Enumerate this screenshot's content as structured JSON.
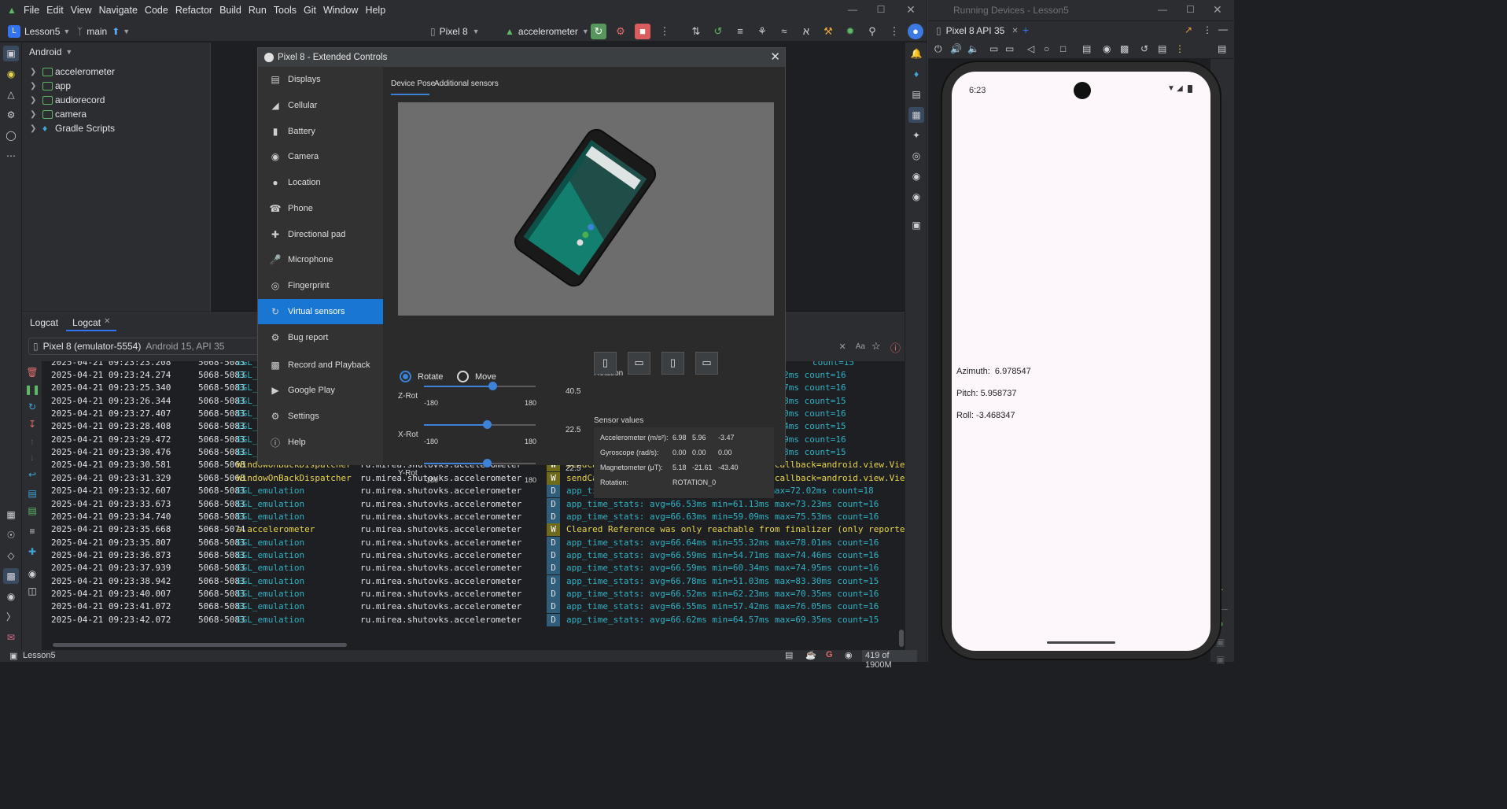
{
  "ide": {
    "menus": [
      "File",
      "Edit",
      "View",
      "Navigate",
      "Code",
      "Refactor",
      "Build",
      "Run",
      "Tools",
      "Git",
      "Window",
      "Help"
    ],
    "project_badge": "L",
    "project_name": "Lesson5",
    "branch": "main",
    "device": "Pixel 8",
    "run_config": "accelerometer",
    "project_view": "Android",
    "tree": [
      "accelerometer",
      "app",
      "audiorecord",
      "camera",
      "Gradle Scripts"
    ],
    "logcat_tabs": [
      "Logcat",
      "Logcat"
    ],
    "logcat_device": "Pixel 8 (emulator-5554)",
    "logcat_device_detail": "Android 15, API 35",
    "search_aa": "Aa",
    "status_project": "Lesson5",
    "memory": "419 of 1900M"
  },
  "logs": [
    {
      "date": "2025-04-21 09:23:24.274",
      "pid": "5068-5083",
      "tag": "EGL_",
      "pkg": "",
      "lvl": "",
      "msg": "=70.52ms count=16"
    },
    {
      "date": "2025-04-21 09:23:25.340",
      "pid": "5068-5083",
      "tag": "EGL_",
      "pkg": "",
      "lvl": "",
      "msg": "=67.47ms count=16"
    },
    {
      "date": "2025-04-21 09:23:26.344",
      "pid": "5068-5083",
      "tag": "EGL_",
      "pkg": "",
      "lvl": "",
      "msg": "=70.68ms count=15"
    },
    {
      "date": "2025-04-21 09:23:27.407",
      "pid": "5068-5083",
      "tag": "EGL_",
      "pkg": "",
      "lvl": "",
      "msg": "=84.00ms count=16"
    },
    {
      "date": "2025-04-21 09:23:28.408",
      "pid": "5068-5083",
      "tag": "EGL_",
      "pkg": "",
      "lvl": "",
      "msg": "=68.84ms count=15"
    },
    {
      "date": "2025-04-21 09:23:29.472",
      "pid": "5068-5083",
      "tag": "EGL_",
      "pkg": "",
      "lvl": "",
      "msg": "=67.79ms count=16"
    },
    {
      "date": "2025-04-21 09:23:30.476",
      "pid": "5068-5083",
      "tag": "EGL_",
      "pkg": "",
      "lvl": "",
      "msg": "=99.43ms count=15"
    },
    {
      "date": "2025-04-21 09:23:30.581",
      "pid": "5068-5068",
      "tag": "WindowOnBackDispatcher",
      "pkg": "ru.mirea.shutovks.accelerometer",
      "lvl": "W",
      "msg": "sendCancelIfRunning: isInProgress=false callback=android.view.View"
    },
    {
      "date": "2025-04-21 09:23:31.329",
      "pid": "5068-5068",
      "tag": "WindowOnBackDispatcher",
      "pkg": "ru.mirea.shutovks.accelerometer",
      "lvl": "W",
      "msg": "sendCancelIfRunning: isInProgress=false callback=android.view.View"
    },
    {
      "date": "2025-04-21 09:23:32.607",
      "pid": "5068-5083",
      "tag": "EGL_emulation",
      "pkg": "ru.mirea.shutovks.accelerometer",
      "lvl": "D",
      "msg": "app_time_stats: avg=58.92ms min=6.45ms max=72.02ms count=18"
    },
    {
      "date": "2025-04-21 09:23:33.673",
      "pid": "5068-5083",
      "tag": "EGL_emulation",
      "pkg": "ru.mirea.shutovks.accelerometer",
      "lvl": "D",
      "msg": "app_time_stats: avg=66.53ms min=61.13ms max=73.23ms count=16"
    },
    {
      "date": "2025-04-21 09:23:34.740",
      "pid": "5068-5083",
      "tag": "EGL_emulation",
      "pkg": "ru.mirea.shutovks.accelerometer",
      "lvl": "D",
      "msg": "app_time_stats: avg=66.63ms min=59.09ms max=75.53ms count=16"
    },
    {
      "date": "2025-04-21 09:23:35.668",
      "pid": "5068-5074",
      "tag": "s.accelerometer",
      "pkg": "ru.mirea.shutovks.accelerometer",
      "lvl": "W",
      "msg": "Cleared Reference was only reachable from finalizer (only reported"
    },
    {
      "date": "2025-04-21 09:23:35.807",
      "pid": "5068-5083",
      "tag": "EGL_emulation",
      "pkg": "ru.mirea.shutovks.accelerometer",
      "lvl": "D",
      "msg": "app_time_stats: avg=66.64ms min=55.32ms max=78.01ms count=16"
    },
    {
      "date": "2025-04-21 09:23:36.873",
      "pid": "5068-5083",
      "tag": "EGL_emulation",
      "pkg": "ru.mirea.shutovks.accelerometer",
      "lvl": "D",
      "msg": "app_time_stats: avg=66.59ms min=54.71ms max=74.46ms count=16"
    },
    {
      "date": "2025-04-21 09:23:37.939",
      "pid": "5068-5083",
      "tag": "EGL_emulation",
      "pkg": "ru.mirea.shutovks.accelerometer",
      "lvl": "D",
      "msg": "app_time_stats: avg=66.59ms min=60.34ms max=74.95ms count=16"
    },
    {
      "date": "2025-04-21 09:23:38.942",
      "pid": "5068-5083",
      "tag": "EGL_emulation",
      "pkg": "ru.mirea.shutovks.accelerometer",
      "lvl": "D",
      "msg": "app_time_stats: avg=66.78ms min=51.03ms max=83.30ms count=15"
    },
    {
      "date": "2025-04-21 09:23:40.007",
      "pid": "5068-5083",
      "tag": "EGL_emulation",
      "pkg": "ru.mirea.shutovks.accelerometer",
      "lvl": "D",
      "msg": "app_time_stats: avg=66.52ms min=62.23ms max=70.35ms count=16"
    },
    {
      "date": "2025-04-21 09:23:41.072",
      "pid": "5068-5083",
      "tag": "EGL_emulation",
      "pkg": "ru.mirea.shutovks.accelerometer",
      "lvl": "D",
      "msg": "app_time_stats: avg=66.55ms min=57.42ms max=76.05ms count=16"
    },
    {
      "date": "2025-04-21 09:23:42.072",
      "pid": "5068-5083",
      "tag": "EGL_emulation",
      "pkg": "ru.mirea.shutovks.accelerometer",
      "lvl": "D",
      "msg": "app_time_stats: avg=66.62ms min=64.57ms max=69.35ms count=15"
    }
  ],
  "extended": {
    "title": "Pixel 8 - Extended Controls",
    "sidebar": [
      "Displays",
      "Cellular",
      "Battery",
      "Camera",
      "Location",
      "Phone",
      "Directional pad",
      "Microphone",
      "Fingerprint",
      "Virtual sensors",
      "Bug report",
      "Record and Playback",
      "Google Play",
      "Settings",
      "Help"
    ],
    "active_item": "Virtual sensors",
    "tabs": [
      "Device Pose",
      "Additional sensors"
    ],
    "mode_rotate": "Rotate",
    "mode_move": "Move",
    "sliders": [
      {
        "label": "Z-Rot",
        "min": "-180",
        "max": "180",
        "value": "40.5",
        "fraction": 0.6125
      },
      {
        "label": "X-Rot",
        "min": "-180",
        "max": "180",
        "value": "22.5",
        "fraction": 0.5625
      },
      {
        "label": "Y-Rot",
        "min": "-180",
        "max": "180",
        "value": "22.5",
        "fraction": 0.5625
      }
    ],
    "rotation_label": "Rotation",
    "sensor_values_label": "Sensor values",
    "sensors": [
      {
        "name": "Accelerometer (m/s²):",
        "v1": "6.98",
        "v2": "5.96",
        "v3": "-3.47"
      },
      {
        "name": "Gyroscope (rad/s):",
        "v1": "0.00",
        "v2": "0.00",
        "v3": "0.00"
      },
      {
        "name": "Magnetometer (μT):",
        "v1": "5.18",
        "v2": "-21.61",
        "v3": "-43.40"
      }
    ],
    "rotation_row_label": "Rotation:",
    "rotation_row_value": "ROTATION_0"
  },
  "running": {
    "title": "Running Devices - Lesson5",
    "tab": "Pixel 8 API 35",
    "time": "6:23",
    "azimuth": "Azimuth:  6.978547",
    "pitch": "Pitch: 5.958737",
    "roll": "Roll: -3.468347"
  },
  "colors": {
    "accent": "#1976d2",
    "tag_green": "#5fb865",
    "log_cyan": "#2fb3c5",
    "warn_yellow": "#e8d44d"
  }
}
